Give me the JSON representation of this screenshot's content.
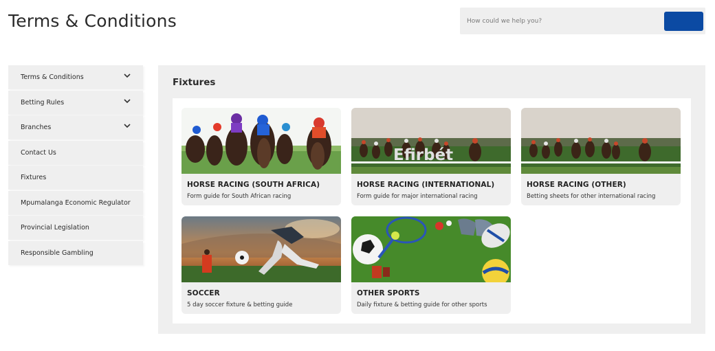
{
  "page": {
    "title": "Terms & Conditions"
  },
  "search": {
    "placeholder": "How could we help you?"
  },
  "sidebar": {
    "items": [
      {
        "label": "Terms & Conditions",
        "expandable": true
      },
      {
        "label": "Betting Rules",
        "expandable": true
      },
      {
        "label": "Branches",
        "expandable": true
      },
      {
        "label": "Contact Us",
        "expandable": false
      },
      {
        "label": "Fixtures",
        "expandable": false
      },
      {
        "label": "Mpumalanga Economic Regulator",
        "expandable": false
      },
      {
        "label": "Provincial Legislation",
        "expandable": false
      },
      {
        "label": "Responsible Gambling",
        "expandable": false
      }
    ]
  },
  "fixtures": {
    "title": "Fixtures",
    "cards": [
      {
        "title": "HORSE RACING (SOUTH AFRICA)",
        "subtitle": "Form guide for South African racing",
        "image": "horse-racing-closeup-image"
      },
      {
        "title": "HORSE RACING (INTERNATIONAL)",
        "subtitle": "Form guide for major international racing",
        "image": "horse-racing-field-image"
      },
      {
        "title": "HORSE RACING (OTHER)",
        "subtitle": "Betting sheets for other international racing",
        "image": "horse-racing-field-image"
      },
      {
        "title": "SOCCER",
        "subtitle": "5 day soccer fixture & betting guide",
        "image": "soccer-player-image"
      },
      {
        "title": "OTHER SPORTS",
        "subtitle": "Daily fixture & betting guide for other sports",
        "image": "sports-balls-image"
      }
    ],
    "watermark": "Efirbét"
  },
  "colors": {
    "accent": "#0b4aa3",
    "panel": "#efefef",
    "sidebar": "#efefef"
  }
}
